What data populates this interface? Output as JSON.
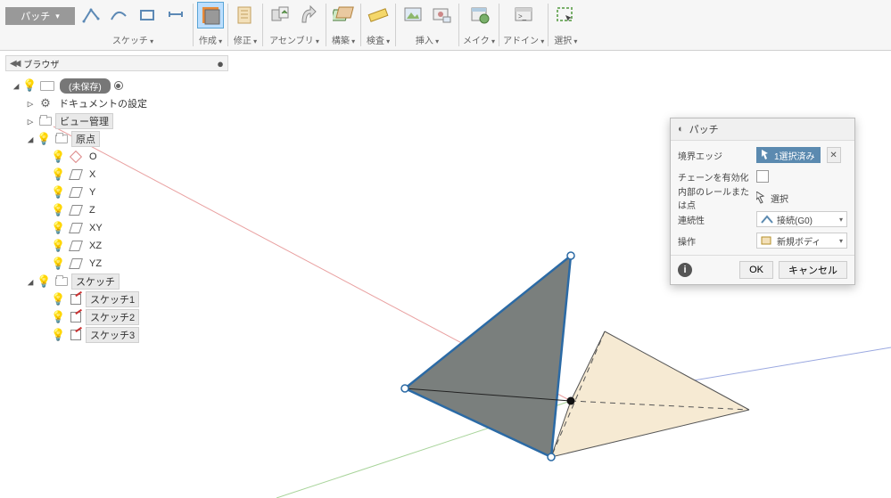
{
  "mode_button": "パッチ",
  "toolbar": {
    "sketch": "スケッチ",
    "create": "作成",
    "modify": "修正",
    "assembly": "アセンブリ",
    "construct": "構築",
    "inspect": "検査",
    "insert": "挿入",
    "make": "メイク",
    "addins": "アドイン",
    "select": "選択"
  },
  "browser": {
    "title": "ブラウザ",
    "arrows": "◀◀"
  },
  "tree": {
    "root": "(未保存)",
    "doc_settings": "ドキュメントの設定",
    "view_mgmt": "ビュー管理",
    "origin": "原点",
    "o": "O",
    "x": "X",
    "y": "Y",
    "z": "Z",
    "xy": "XY",
    "xz": "XZ",
    "yz": "YZ",
    "sketches": "スケッチ",
    "sk1": "スケッチ1",
    "sk2": "スケッチ2",
    "sk3": "スケッチ3"
  },
  "dialog": {
    "title": "パッチ",
    "edges_label": "境界エッジ",
    "edges_value": "1選択済み",
    "chain_label": "チェーンを有効化",
    "rails_label": "内部のレールまたは点",
    "rails_value": "選択",
    "continuity_label": "連続性",
    "continuity_value": "接続(G0)",
    "operation_label": "操作",
    "operation_value": "新規ボディ",
    "ok": "OK",
    "cancel": "キャンセル"
  }
}
